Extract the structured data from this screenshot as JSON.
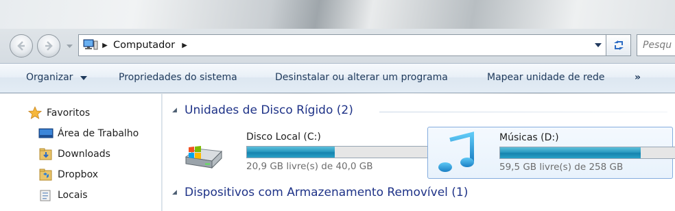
{
  "address_bar": {
    "location": "Computador",
    "search_placeholder": "Pesqu"
  },
  "command_bar": {
    "organize": "Organizar",
    "system_properties": "Propriedades do sistema",
    "uninstall": "Desinstalar ou alterar um programa",
    "map_drive": "Mapear unidade de rede",
    "more": "»"
  },
  "nav_pane": {
    "items": [
      {
        "label": "Favoritos",
        "icon": "star-icon"
      },
      {
        "label": "Área de Trabalho",
        "icon": "desktop-icon"
      },
      {
        "label": "Downloads",
        "icon": "downloads-folder-icon"
      },
      {
        "label": "Dropbox",
        "icon": "dropbox-folder-icon"
      },
      {
        "label": "Locais",
        "icon": "recent-places-icon"
      }
    ]
  },
  "groups": {
    "hard_disks": "Unidades de Disco Rígido (2)",
    "removable": "Dispositivos com Armazenamento Removível (1)"
  },
  "drives": [
    {
      "name": "Disco Local (C:)",
      "free_text": "20,9 GB livre(s) de 40,0 GB",
      "used_fraction": 0.48,
      "icon": "hard-drive-windows-icon"
    },
    {
      "name": "Músicas (D:)",
      "free_text": "59,5 GB livre(s) de 258 GB",
      "used_fraction": 0.77,
      "icon": "music-note-icon"
    }
  ],
  "colors": {
    "accent_text": "#1e3287",
    "bar_fill": "#1683ae",
    "selection_border": "#84acdd"
  }
}
